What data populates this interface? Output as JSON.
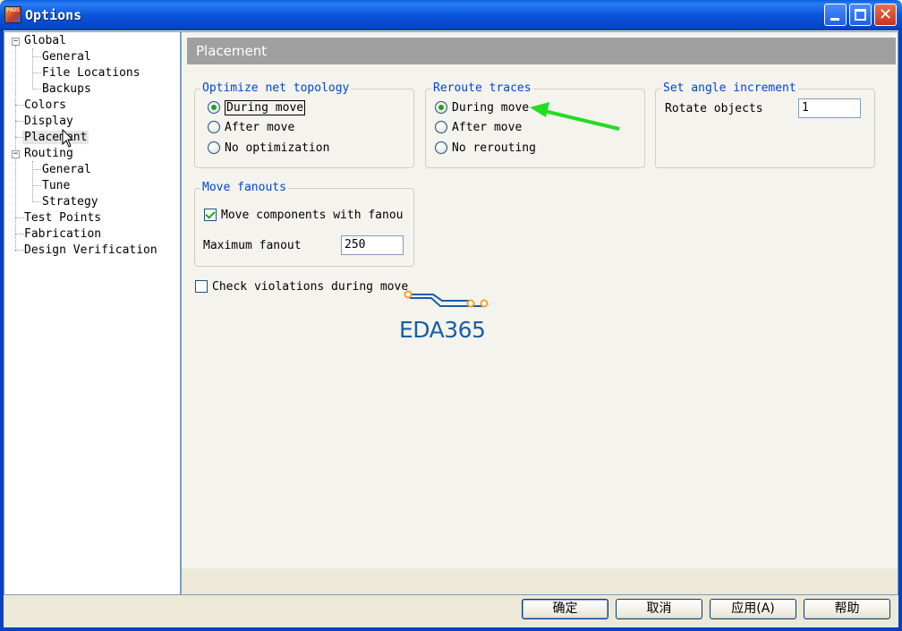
{
  "window": {
    "title": "Options",
    "app_icon_label": "PADS",
    "close_glyph": "✕"
  },
  "tree": {
    "items": [
      {
        "label": "Global",
        "level": 0,
        "expander": "−"
      },
      {
        "label": "General",
        "level": 1
      },
      {
        "label": "File Locations",
        "level": 1
      },
      {
        "label": "Backups",
        "level": 1
      },
      {
        "label": "Colors",
        "level": 0
      },
      {
        "label": "Display",
        "level": 0
      },
      {
        "label": "Placement",
        "level": 0,
        "selected": true
      },
      {
        "label": "Routing",
        "level": 0,
        "expander": "−"
      },
      {
        "label": "General",
        "level": 1
      },
      {
        "label": "Tune",
        "level": 1
      },
      {
        "label": "Strategy",
        "level": 1
      },
      {
        "label": "Test Points",
        "level": 0
      },
      {
        "label": "Fabrication",
        "level": 0
      },
      {
        "label": "Design Verification",
        "level": 0
      }
    ]
  },
  "panel": {
    "header": "Placement",
    "optimize": {
      "legend": "Optimize net topology",
      "options": [
        {
          "label": "During move",
          "checked": true
        },
        {
          "label": "After move",
          "checked": false
        },
        {
          "label": "No optimization",
          "checked": false
        }
      ]
    },
    "reroute": {
      "legend": "Reroute traces",
      "options": [
        {
          "label": "During move",
          "checked": true
        },
        {
          "label": "After move",
          "checked": false
        },
        {
          "label": "No rerouting",
          "checked": false
        }
      ]
    },
    "angle": {
      "legend": "Set angle increment",
      "rotate_label": "Rotate objects",
      "rotate_value": "1"
    },
    "fanouts": {
      "legend": "Move fanouts",
      "move_components_label": "Move components with fanou",
      "move_components_checked": true,
      "max_fanout_label": "Maximum fanout",
      "max_fanout_value": "250"
    },
    "check_violations": {
      "label": "Check violations during move",
      "checked": false
    },
    "watermark": "EDA365"
  },
  "buttons": {
    "ok": "确定",
    "cancel": "取消",
    "apply": "应用(A)",
    "help": "帮助"
  },
  "colors": {
    "titlebar": "#0855dd",
    "legend_text": "#0046d5",
    "annotation_arrow": "#22dd22",
    "watermark": "#1a5ea8"
  }
}
